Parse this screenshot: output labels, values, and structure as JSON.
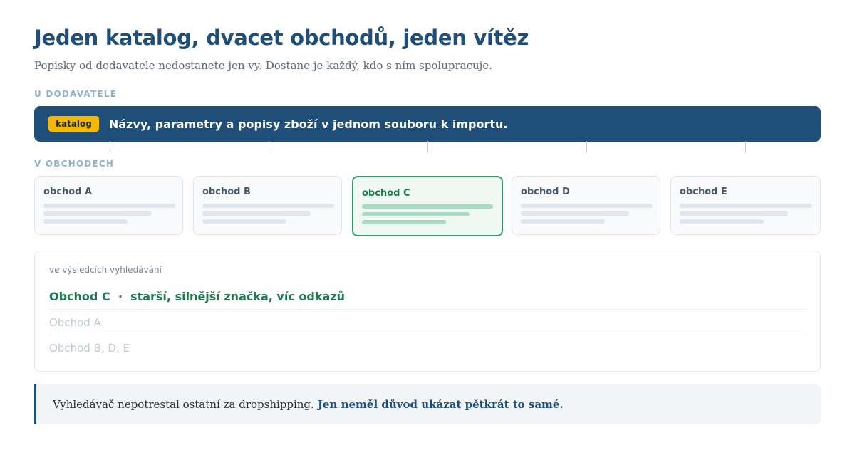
{
  "title": "Jeden katalog, dvacet obchodů, jeden vítěz",
  "subtitle": "Popisky od dodavatele nedostanete jen vy. Dostane je každý, kdo s ním spolupracuje.",
  "supplier": {
    "section_label": "U DODAVATELE",
    "badge": "katalog",
    "text": "Názvy, parametry a popisy zboží v jednom souboru k importu."
  },
  "shops": {
    "section_label": "V OBCHODECH",
    "items": [
      {
        "name": "obchod A",
        "highlighted": false
      },
      {
        "name": "obchod B",
        "highlighted": false
      },
      {
        "name": "obchod C",
        "highlighted": true
      },
      {
        "name": "obchod D",
        "highlighted": false
      },
      {
        "name": "obchod E",
        "highlighted": false
      }
    ]
  },
  "search_results": {
    "label": "ve výsledcích vyhledávání",
    "winner": "Obchod C  ·  starší, silnější značka, víc odkazů",
    "rows": [
      "Obchod A",
      "Obchod B, D, E"
    ]
  },
  "callout": {
    "text": "Vyhledávač nepotrestal ostatní za dropshipping.",
    "emphasis": "Jen neměl důvod ukázat pětkrát to samé."
  },
  "colors": {
    "brand": "#1f4e79",
    "accent_badge": "#f5b800",
    "winner_green": "#1c7a4f"
  }
}
